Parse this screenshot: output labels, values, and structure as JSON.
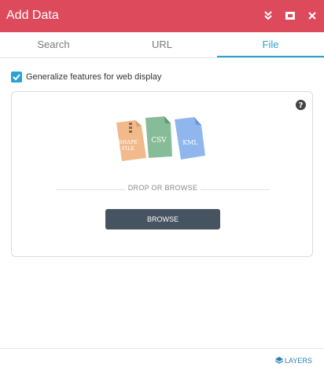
{
  "window": {
    "title": "Add Data",
    "controls": [
      "collapse-icon",
      "dock-icon",
      "close-icon"
    ],
    "accent_color": "#dd4a5c"
  },
  "tabs": [
    {
      "label": "Search",
      "active": false
    },
    {
      "label": "URL",
      "active": false
    },
    {
      "label": "File",
      "active": true
    }
  ],
  "options": {
    "generalize_label": "Generalize features for web display",
    "generalize_checked": true
  },
  "dropzone": {
    "help_icon": "question-icon",
    "file_types": [
      {
        "label_line1": "SHAPE",
        "label_line2": "FILE",
        "color": "#f2b98a"
      },
      {
        "label": "CSV",
        "color": "#86bd98"
      },
      {
        "label": "KML",
        "color": "#8fb7ee"
      }
    ],
    "divider_text": "DROP OR BROWSE",
    "browse_label": "BROWSE"
  },
  "footer": {
    "layers_label": "LAYERS",
    "layers_icon": "layers-icon"
  }
}
